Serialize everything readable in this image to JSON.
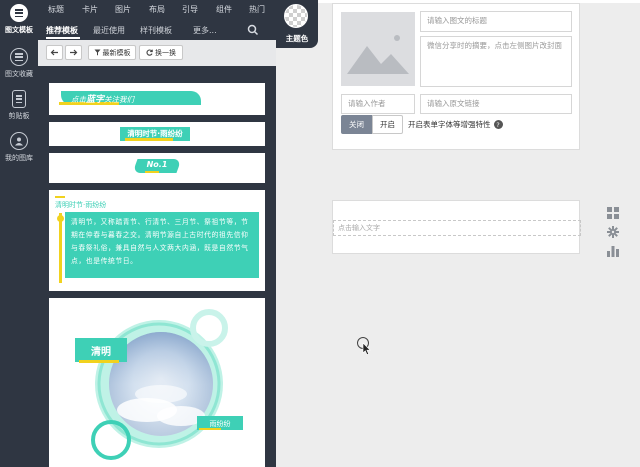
{
  "rail": {
    "items": [
      {
        "label": "图文模板",
        "active": true
      },
      {
        "label": "图文收藏",
        "active": false
      },
      {
        "label": "剪贴板",
        "active": false
      },
      {
        "label": "我的图库",
        "active": false
      }
    ]
  },
  "nav": {
    "links": [
      "标题",
      "卡片",
      "图片",
      "布局",
      "引导",
      "组件",
      "热门"
    ]
  },
  "theme": {
    "label": "主题色"
  },
  "panel": {
    "tabs": [
      "推荐模板",
      "最近使用",
      "样刊模板",
      "更多..."
    ],
    "toolbar": {
      "filter_label": "最新模板",
      "switch_label": "换一换"
    },
    "templates": {
      "t1": {
        "text_pre": "点击",
        "text_strong": "蓝字",
        "text_post": "关注我们"
      },
      "t2": {
        "title": "清明时节·雨纷纷"
      },
      "t3": {
        "badge": "No.1"
      },
      "t4": {
        "heading": "清明时节·雨纷纷",
        "body": "清明节，又称踏青节、行清节、三月节、祭祖节等，节期在仲春与暮春之交。清明节源自上古时代的祖先信仰与春祭礼俗，兼具自然与人文两大内涵，既是自然节气点，也是传统节日。"
      },
      "t5": {
        "label": "清明",
        "tag": "雨纷纷"
      }
    }
  },
  "editor": {
    "title_placeholder": "请输入图文的标题",
    "summary_placeholder": "微信分享时的摘要，点击左侧图片改封面",
    "author_placeholder": "请输入作者",
    "link_placeholder": "请输入原文链接",
    "toggle_off": "关闭",
    "toggle_on": "开启",
    "toggle_desc": "开启表单字体等增强特性",
    "content_placeholder": "点击输入文字"
  },
  "colors": {
    "sidebar_bg": "#2f3642",
    "accent_teal": "#3ed0b6",
    "accent_yellow": "#f1d21e",
    "toggle_off_bg": "#7b8595"
  },
  "icons": [
    "search-icon",
    "filter-icon",
    "refresh-icon",
    "grid-icon",
    "gear-icon",
    "bar-chart-icon",
    "help-icon",
    "image-placeholder-icon"
  ]
}
